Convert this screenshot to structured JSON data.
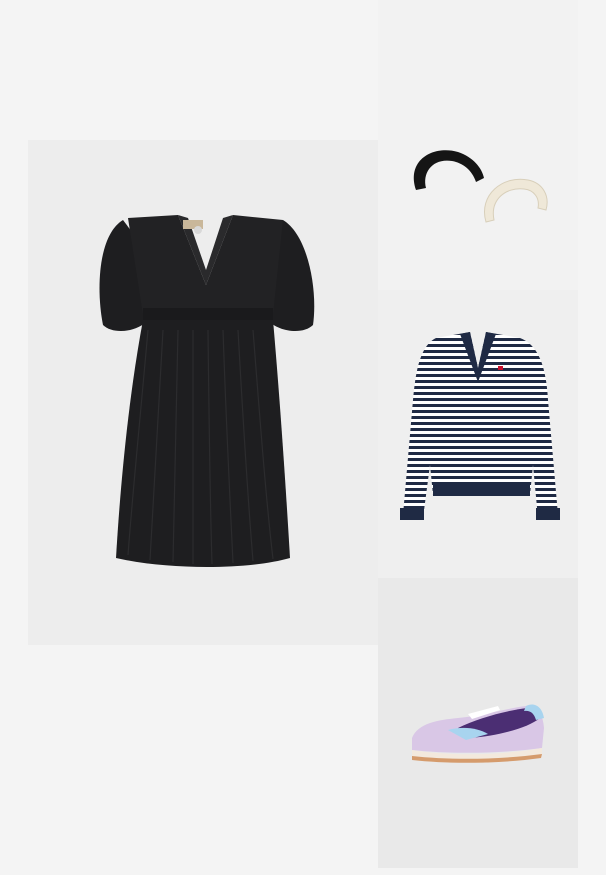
{
  "outfit": {
    "items": [
      {
        "id": "dress",
        "icon": "black-mini-dress-image",
        "color": "#1e1e20"
      },
      {
        "id": "headbands",
        "icon": "padded-headbands-image",
        "colors": [
          "#151515",
          "#efe8d8"
        ]
      },
      {
        "id": "sweater",
        "icon": "striped-v-neck-sweater-image",
        "colors": [
          "#1f2a44",
          "#ffffff"
        ]
      },
      {
        "id": "sneakers",
        "icon": "purple-sneaker-image",
        "colors": [
          "#4b2e73",
          "#d9c7e6",
          "#a8d4ef"
        ]
      }
    ]
  }
}
